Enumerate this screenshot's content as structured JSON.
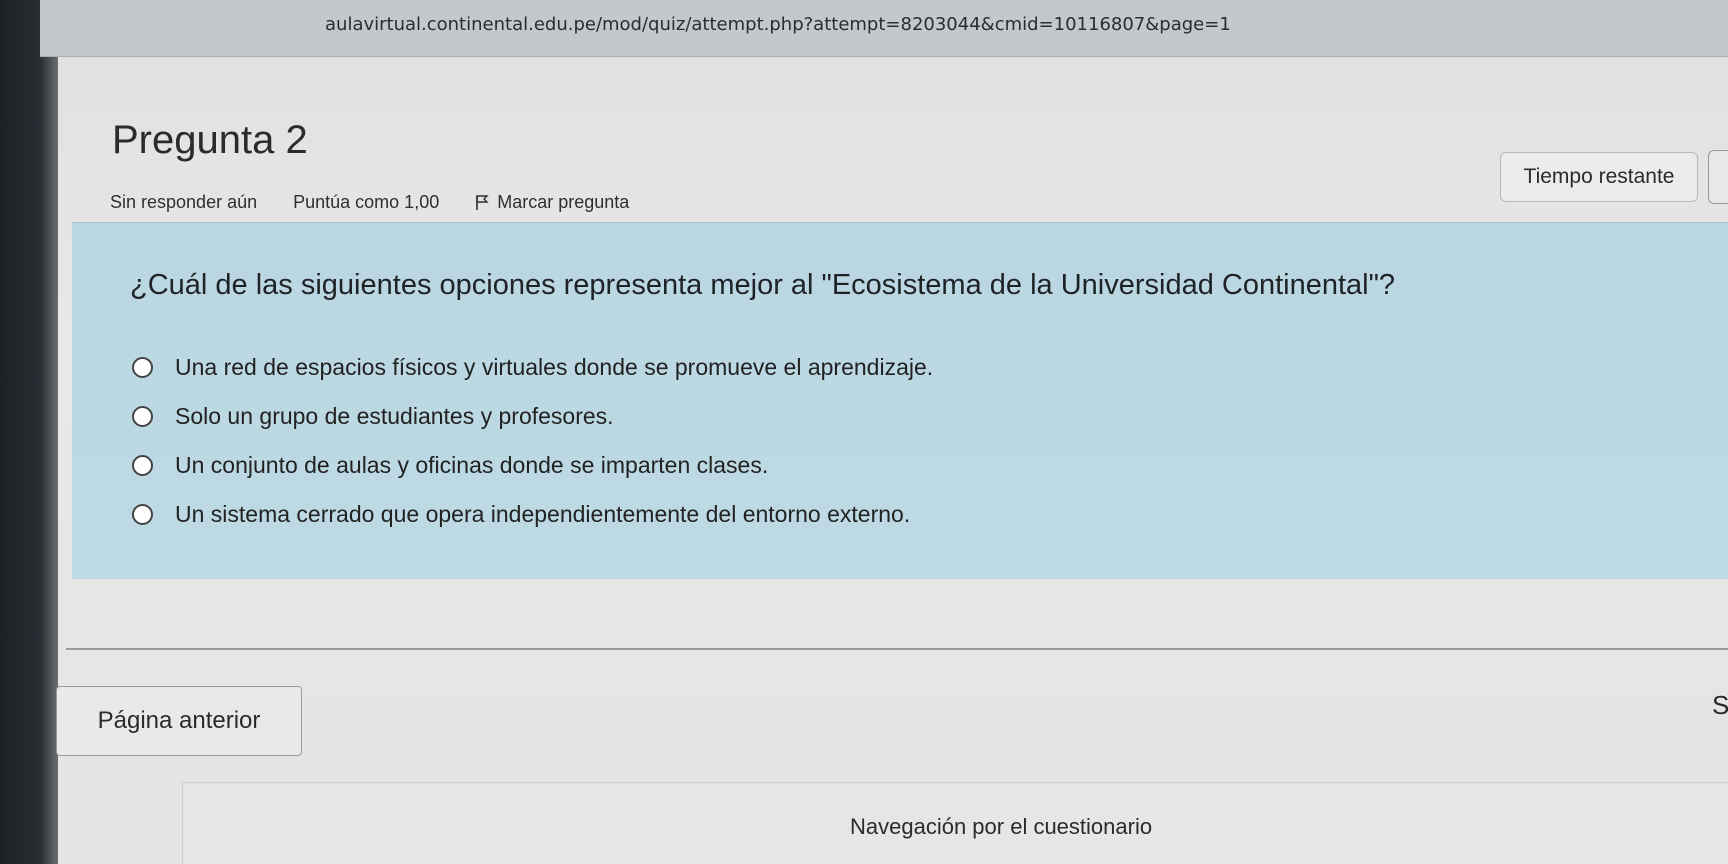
{
  "browser": {
    "url": "aulavirtual.continental.edu.pe/mod/quiz/attempt.php?attempt=8203044&cmid=10116807&page=1",
    "bookmark_icon": "star-icon"
  },
  "question": {
    "title": "Pregunta 2",
    "status": "Sin responder aún",
    "points": "Puntúa como 1,00",
    "flag_label": "Marcar pregunta",
    "flag_icon": "flag-icon",
    "text": "¿Cuál de las siguientes opciones representa mejor al \"Ecosistema de la Universidad Continental\"?",
    "options": [
      {
        "label": "Una red de espacios físicos y virtuales donde se promueve el aprendizaje."
      },
      {
        "label": "Solo un grupo de estudiantes y profesores."
      },
      {
        "label": "Un conjunto de aulas y oficinas donde se imparten clases."
      },
      {
        "label": "Un sistema cerrado que opera independientemente del entorno externo."
      }
    ]
  },
  "timer": {
    "label": "Tiempo restante"
  },
  "navigation": {
    "prev_label": "Página anterior",
    "next_label_partial": "Si",
    "quiz_nav_title": "Navegación por el cuestionario"
  },
  "colors": {
    "question_panel": "#bedae4",
    "background": "#e6e6e4"
  }
}
